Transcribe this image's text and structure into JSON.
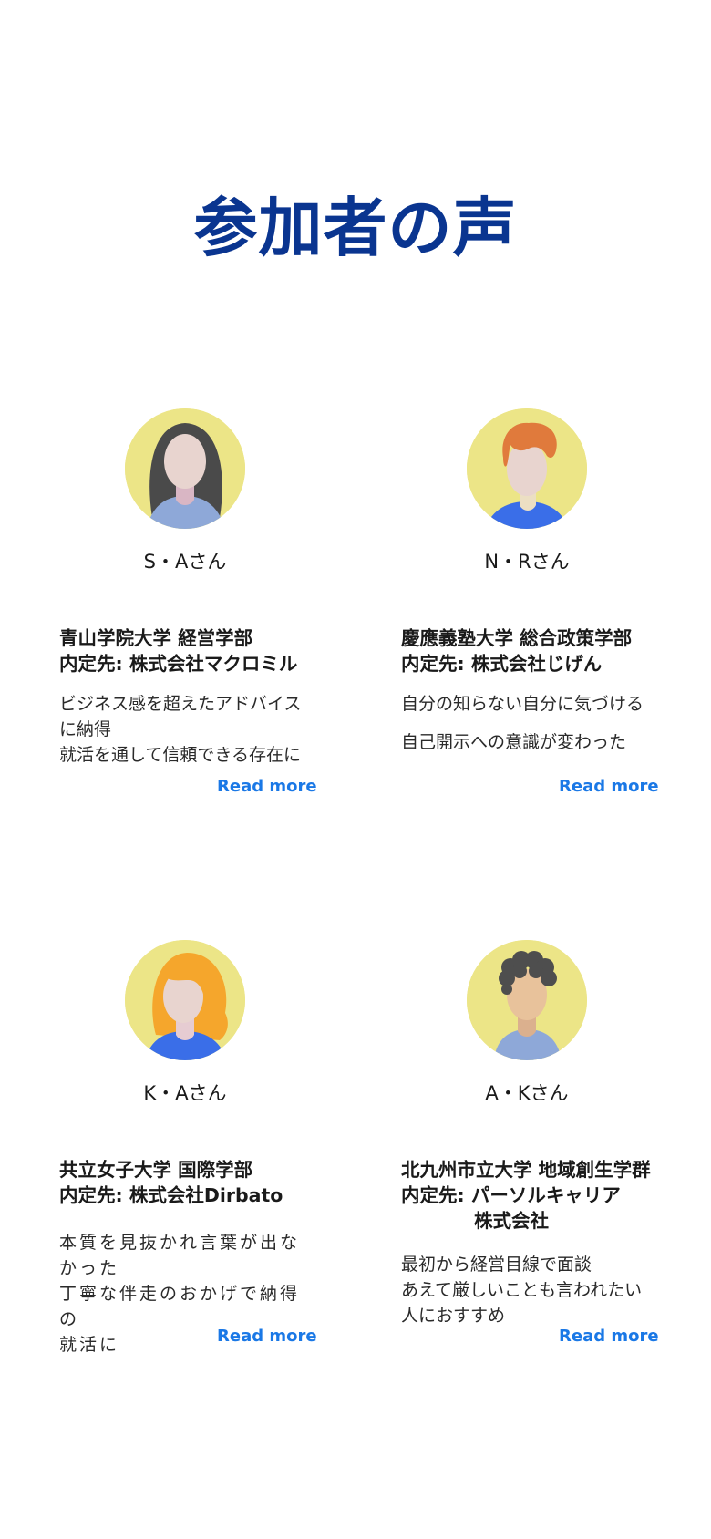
{
  "page": {
    "title": "参加者の声"
  },
  "colors": {
    "title": "#0a3590",
    "link": "#1a78e6",
    "avatar_bg": "#ece587"
  },
  "testimonials": [
    {
      "name": "S・Aさん",
      "school": "青山学院大学  経営学部",
      "offer_label": "内定先: ",
      "company": "株式会社マクロミル",
      "comment_lines": [
        "ビジネス感を超えたアドバイス",
        "に納得",
        "就活を通して信頼できる存在に"
      ],
      "read_more": "Read more",
      "avatar": "avatar-woman-long-dark-hair"
    },
    {
      "name": "N・Rさん",
      "school": "慶應義塾大学 総合政策学部",
      "offer_label": "内定先: ",
      "company": "株式会社じげん",
      "comment_lines": [
        "自分の知らない自分に気づける",
        "自己開示への意識が変わった"
      ],
      "read_more": "Read more",
      "avatar": "avatar-man-orange-hair"
    },
    {
      "name": "K・Aさん",
      "school": "共立女子大学 国際学部",
      "offer_label": "内定先: ",
      "company": "株式会社Dirbato",
      "comment_lines": [
        "本質を見抜かれ言葉が出な",
        "かった",
        "丁寧な伴走のおかげで納得の",
        "就活に"
      ],
      "read_more": "Read more",
      "avatar": "avatar-woman-orange-hair"
    },
    {
      "name": "A・Kさん",
      "school": "北九州市立大学 地域創生学群",
      "offer_label": "内定先: ",
      "company_line1": "パーソルキャリア",
      "company_line2": "株式会社",
      "comment_lines": [
        "最初から経営目線で面談",
        "あえて厳しいことも言われたい",
        "人におすすめ"
      ],
      "read_more": "Read more",
      "avatar": "avatar-man-curly-hair"
    }
  ]
}
